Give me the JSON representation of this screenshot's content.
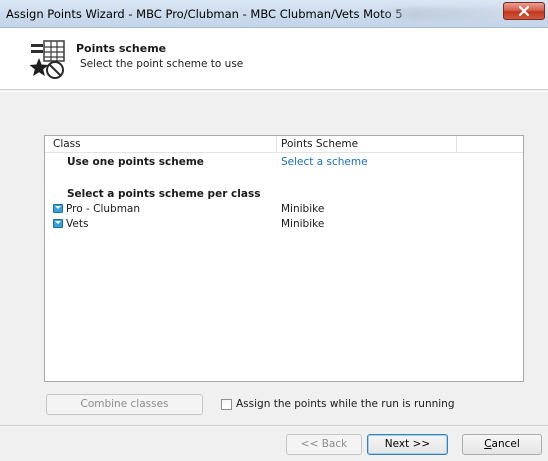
{
  "window": {
    "title": "Assign Points Wizard - MBC Pro/Clubman - MBC Clubman/Vets Moto 5",
    "close_icon": "close-icon"
  },
  "header": {
    "title": "Points scheme",
    "subtitle": "Select the point scheme to use",
    "icon": "points-scheme-icon"
  },
  "grid": {
    "columns": [
      "Class",
      "Points Scheme",
      ""
    ],
    "rows": [
      {
        "kind": "option",
        "class": "Use one points scheme",
        "scheme": "Select a scheme",
        "scheme_is_link": true
      },
      {
        "kind": "spacer",
        "class": "",
        "scheme": ""
      },
      {
        "kind": "option",
        "class": "Select a points scheme per class",
        "scheme": ""
      },
      {
        "kind": "class",
        "class": "Pro - Clubman",
        "scheme": "Minibike"
      },
      {
        "kind": "class",
        "class": "Vets",
        "scheme": "Minibike"
      }
    ]
  },
  "footer": {
    "combine_label": "Combine classes",
    "assign_checkbox_label": "Assign the points while the run is running",
    "assign_checked": false,
    "back_label": "<< Back",
    "next_label": "Next >>",
    "cancel_label": "Cancel"
  },
  "colors": {
    "link": "#1a6fc0",
    "title_bar": "#cddcee",
    "close_button": "#c2361f"
  }
}
